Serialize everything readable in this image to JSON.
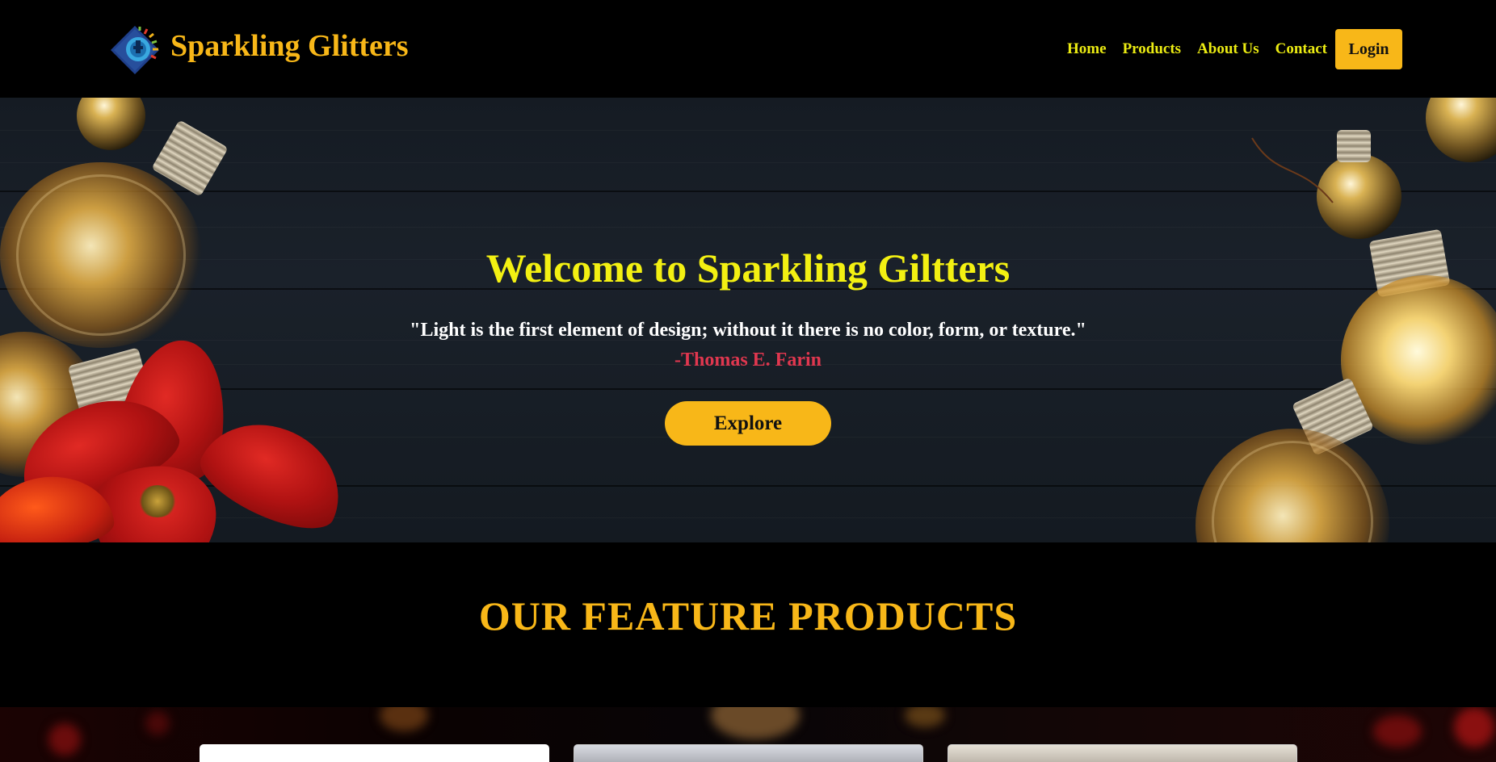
{
  "brand": {
    "name": "Sparkling Glitters",
    "logo_icon": "diamond-bulb-logo-icon"
  },
  "nav": {
    "links": [
      "Home",
      "Products",
      "About Us",
      "Contact"
    ],
    "login_label": "Login"
  },
  "hero": {
    "title": "Welcome to Sparkling Giltters",
    "quote": "\"Light is the first element of design; without it there is no color, form, or texture.\"",
    "author": "-Thomas E. Farin",
    "explore_label": "Explore"
  },
  "feature": {
    "title": "OUR FEATURE PRODUCTS"
  },
  "colors": {
    "accent": "#f8b718",
    "nav_link": "#ecec12",
    "hero_title": "#f3f012",
    "author": "#e0374f",
    "background": "#000000"
  }
}
